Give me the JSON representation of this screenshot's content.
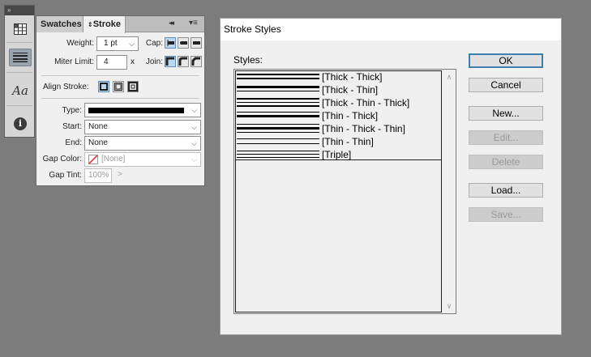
{
  "toolstrip": {
    "collapse_glyph": "»",
    "tools": [
      {
        "name": "swatches-grid-icon"
      },
      {
        "name": "stroke-lines-icon",
        "active": true
      },
      {
        "name": "character-styles-icon",
        "label": "Aa"
      },
      {
        "name": "info-icon",
        "label": "i"
      }
    ]
  },
  "stroke_panel": {
    "tabs": {
      "swatches": "Swatches",
      "stroke": "Stroke"
    },
    "collapse_glyph": "◂◂",
    "menu_glyph": "▾≡",
    "weight_label": "Weight:",
    "weight_value": "1 pt",
    "cap_label": "Cap:",
    "miter_label": "Miter Limit:",
    "miter_value": "4",
    "miter_unit": "x",
    "join_label": "Join:",
    "align_label": "Align Stroke:",
    "type_label": "Type:",
    "start_label": "Start:",
    "start_value": "None",
    "end_label": "End:",
    "end_value": "None",
    "gap_color_label": "Gap Color:",
    "gap_color_value": "[None]",
    "gap_tint_label": "Gap Tint:",
    "gap_tint_value": "100%",
    "gap_tint_arrow": ">"
  },
  "dialog": {
    "title": "Stroke Styles",
    "styles_label": "Styles:",
    "styles": [
      {
        "label": "[Thick - Thick]"
      },
      {
        "label": "[Thick - Thin]"
      },
      {
        "label": "[Thick - Thin - Thick]"
      },
      {
        "label": "[Thin - Thick]"
      },
      {
        "label": "[Thin - Thick - Thin]"
      },
      {
        "label": "[Thin - Thin]"
      },
      {
        "label": "[Triple]"
      }
    ],
    "buttons": {
      "ok": "OK",
      "cancel": "Cancel",
      "new": "New...",
      "edit": "Edit...",
      "delete": "Delete",
      "load": "Load...",
      "save": "Save..."
    }
  }
}
